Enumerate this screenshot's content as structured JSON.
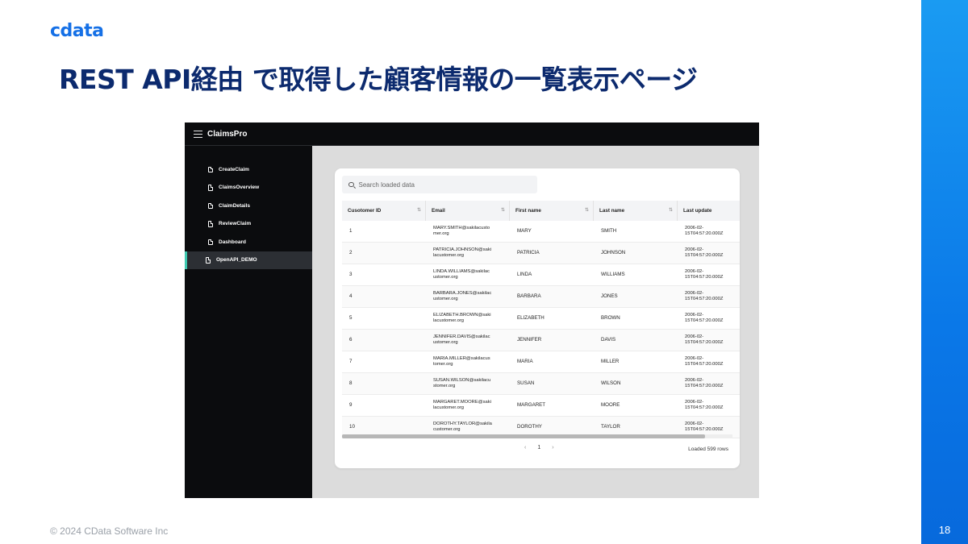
{
  "slide": {
    "logo": "cdata",
    "title": "REST API経由 で取得した顧客情報の一覧表示ページ",
    "copyright": "© 2024 CData Software Inc",
    "page_number": "18",
    "accent_color": "#0a78e8",
    "title_color": "#0c2a6e"
  },
  "app": {
    "name": "ClaimsPro",
    "menu_icon": "hamburger-icon",
    "nav": [
      {
        "label": "CreateClaim",
        "active": false
      },
      {
        "label": "ClaimsOverview",
        "active": false
      },
      {
        "label": "ClaimDetails",
        "active": false
      },
      {
        "label": "ReviewClaim",
        "active": false
      },
      {
        "label": "Dashboard",
        "active": false
      },
      {
        "label": "OpenAPI_DEMO",
        "active": true
      }
    ],
    "search": {
      "placeholder": "Search loaded data",
      "value": ""
    },
    "columns": [
      "Cusotomer ID",
      "Email",
      "First name",
      "Last name",
      "Last update"
    ],
    "rows": [
      {
        "id": "1",
        "email_1": "MARY.SMITH@sakilacusto",
        "email_2": "mer.org",
        "first": "MARY",
        "last": "SMITH",
        "upd_1": "2006-02-",
        "upd_2": "15T04:57:20.000Z"
      },
      {
        "id": "2",
        "email_1": "PATRICIA.JOHNSON@saki",
        "email_2": "lacustomer.org",
        "first": "PATRICIA",
        "last": "JOHNSON",
        "upd_1": "2006-02-",
        "upd_2": "15T04:57:20.000Z"
      },
      {
        "id": "3",
        "email_1": "LINDA.WILLIAMS@sakilac",
        "email_2": "ustomer.org",
        "first": "LINDA",
        "last": "WILLIAMS",
        "upd_1": "2006-02-",
        "upd_2": "15T04:57:20.000Z"
      },
      {
        "id": "4",
        "email_1": "BARBARA.JONES@sakilac",
        "email_2": "ustomer.org",
        "first": "BARBARA",
        "last": "JONES",
        "upd_1": "2006-02-",
        "upd_2": "15T04:57:20.000Z"
      },
      {
        "id": "5",
        "email_1": "ELIZABETH.BROWN@saki",
        "email_2": "lacustomer.org",
        "first": "ELIZABETH",
        "last": "BROWN",
        "upd_1": "2006-02-",
        "upd_2": "15T04:57:20.000Z"
      },
      {
        "id": "6",
        "email_1": "JENNIFER.DAVIS@sakilac",
        "email_2": "ustomer.org",
        "first": "JENNIFER",
        "last": "DAVIS",
        "upd_1": "2006-02-",
        "upd_2": "15T04:57:20.000Z"
      },
      {
        "id": "7",
        "email_1": "MARIA.MILLER@sakilacus",
        "email_2": "tomer.org",
        "first": "MARIA",
        "last": "MILLER",
        "upd_1": "2006-02-",
        "upd_2": "15T04:57:20.000Z"
      },
      {
        "id": "8",
        "email_1": "SUSAN.WILSON@sakilacu",
        "email_2": "stomer.org",
        "first": "SUSAN",
        "last": "WILSON",
        "upd_1": "2006-02-",
        "upd_2": "15T04:57:20.000Z"
      },
      {
        "id": "9",
        "email_1": "MARGARET.MOORE@saki",
        "email_2": "lacustomer.org",
        "first": "MARGARET",
        "last": "MOORE",
        "upd_1": "2006-02-",
        "upd_2": "15T04:57:20.000Z"
      },
      {
        "id": "10",
        "email_1": "DOROTHY.TAYLOR@sakila",
        "email_2": "customer.org",
        "first": "DOROTHY",
        "last": "TAYLOR",
        "upd_1": "2006-02-",
        "upd_2": "15T04:57:20.000Z"
      }
    ],
    "pager": {
      "prev": "‹",
      "page": "1",
      "next": "›"
    },
    "loaded_rows": "Loaded 599 rows",
    "sort_icon": "sort-icon",
    "active_nav_color": "#3ec9b0"
  }
}
